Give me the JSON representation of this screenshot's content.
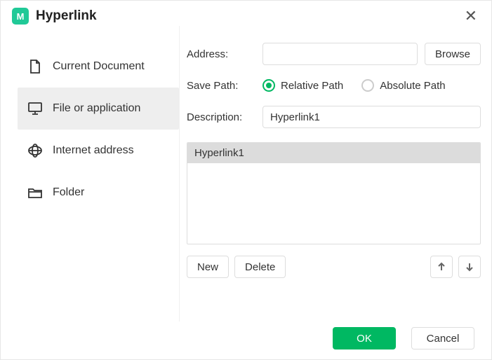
{
  "header": {
    "title": "Hyperlink"
  },
  "sidebar": {
    "items": [
      {
        "label": "Current Document"
      },
      {
        "label": "File or application"
      },
      {
        "label": "Internet address"
      },
      {
        "label": "Folder"
      }
    ],
    "selected_index": 1
  },
  "form": {
    "address_label": "Address:",
    "address_value": "",
    "browse_label": "Browse",
    "savepath_label": "Save Path:",
    "relative_label": "Relative Path",
    "absolute_label": "Absolute Path",
    "savepath_value": "relative",
    "description_label": "Description:",
    "description_value": "Hyperlink1"
  },
  "list": {
    "items": [
      "Hyperlink1"
    ],
    "selected_index": 0
  },
  "actions": {
    "new_label": "New",
    "delete_label": "Delete"
  },
  "footer": {
    "ok_label": "OK",
    "cancel_label": "Cancel"
  }
}
